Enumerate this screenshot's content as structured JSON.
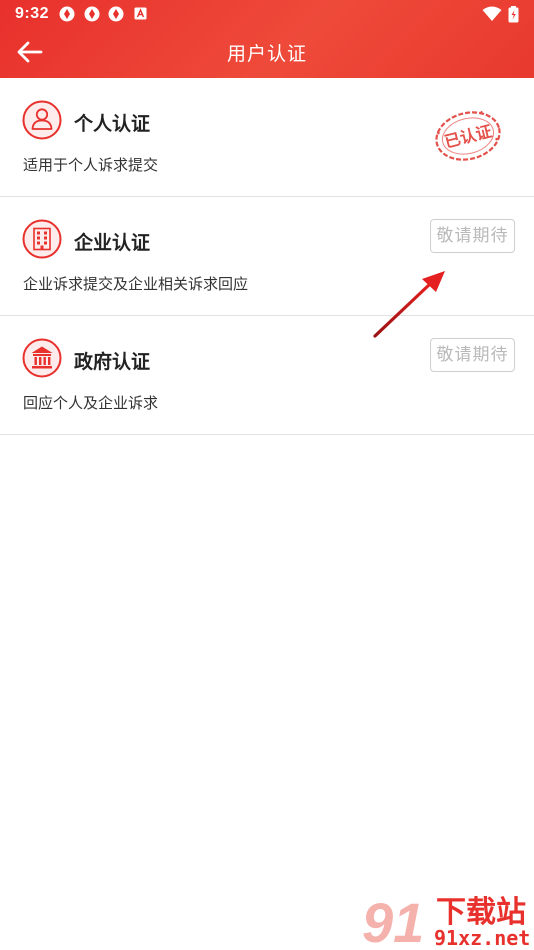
{
  "status_bar": {
    "time": "9:32"
  },
  "header": {
    "title": "用户认证"
  },
  "cards": [
    {
      "name": "个人认证",
      "desc": "适用于个人诉求提交",
      "stamp_text": "已认证"
    },
    {
      "name": "企业认证",
      "desc": "企业诉求提交及企业相关诉求回应",
      "button": "敬请期待"
    },
    {
      "name": "政府认证",
      "desc": "回应个人及企业诉求",
      "button": "敬请期待"
    }
  ],
  "watermark": {
    "title": "下载站",
    "url": "91xz.net",
    "logo": "91"
  },
  "colors": {
    "brand_red": "#e8302c",
    "disabled_text": "#b9b9b9"
  },
  "icons": [
    "sync-icon",
    "sync-icon",
    "sync-icon",
    "notification-a-icon",
    "wifi-icon",
    "battery-icon",
    "back-arrow-icon",
    "person-icon",
    "building-icon",
    "government-icon"
  ]
}
